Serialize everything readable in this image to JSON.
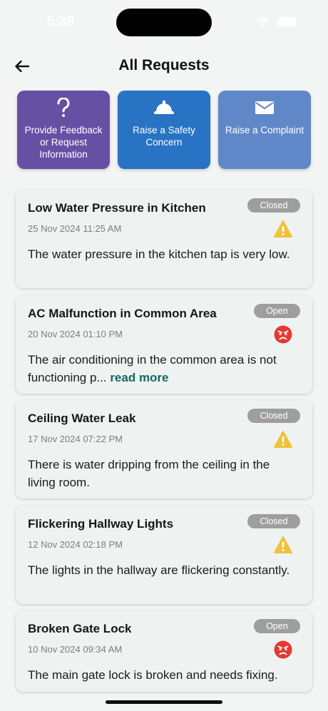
{
  "status_bar": {
    "time": "5:38"
  },
  "header": {
    "title": "All Requests"
  },
  "actions": [
    {
      "label": "Provide Feedback or Request Information",
      "icon": "question-icon",
      "color": "#6650a4"
    },
    {
      "label": "Raise a Safety Concern",
      "icon": "hard-hat-icon",
      "color": "#2873c4"
    },
    {
      "label": "Raise a Complaint",
      "icon": "envelope-icon",
      "color": "#6088c8"
    }
  ],
  "requests": [
    {
      "title": "Low Water Pressure in Kitchen",
      "date": "25 Nov 2024 11:25 AM",
      "status": "Closed",
      "severity_icon": "warning-icon",
      "description": "The water pressure in the kitchen tap is very low."
    },
    {
      "title": "AC Malfunction in Common Area",
      "date": "20 Nov 2024 01:10 PM",
      "status": "Open",
      "severity_icon": "angry-face-icon",
      "description": "The air conditioning in the common area is not functioning p...",
      "read_more": "read more"
    },
    {
      "title": "Ceiling Water Leak",
      "date": "17 Nov 2024 07:22 PM",
      "status": "Closed",
      "severity_icon": "warning-icon",
      "description": "There is water dripping from the ceiling in the living room."
    },
    {
      "title": "Flickering Hallway Lights",
      "date": "12 Nov 2024 02:18 PM",
      "status": "Closed",
      "severity_icon": "warning-icon",
      "description": "The lights in the hallway are flickering constantly."
    },
    {
      "title": "Broken Gate Lock",
      "date": "10 Nov 2024 09:34 AM",
      "status": "Open",
      "severity_icon": "angry-face-icon",
      "description": "The main gate lock is broken and needs fixing."
    }
  ],
  "colors": {
    "warning": "#f2c13a",
    "angry": "#e53935",
    "status_badge": "#9e9e9e",
    "link": "#116b63"
  }
}
